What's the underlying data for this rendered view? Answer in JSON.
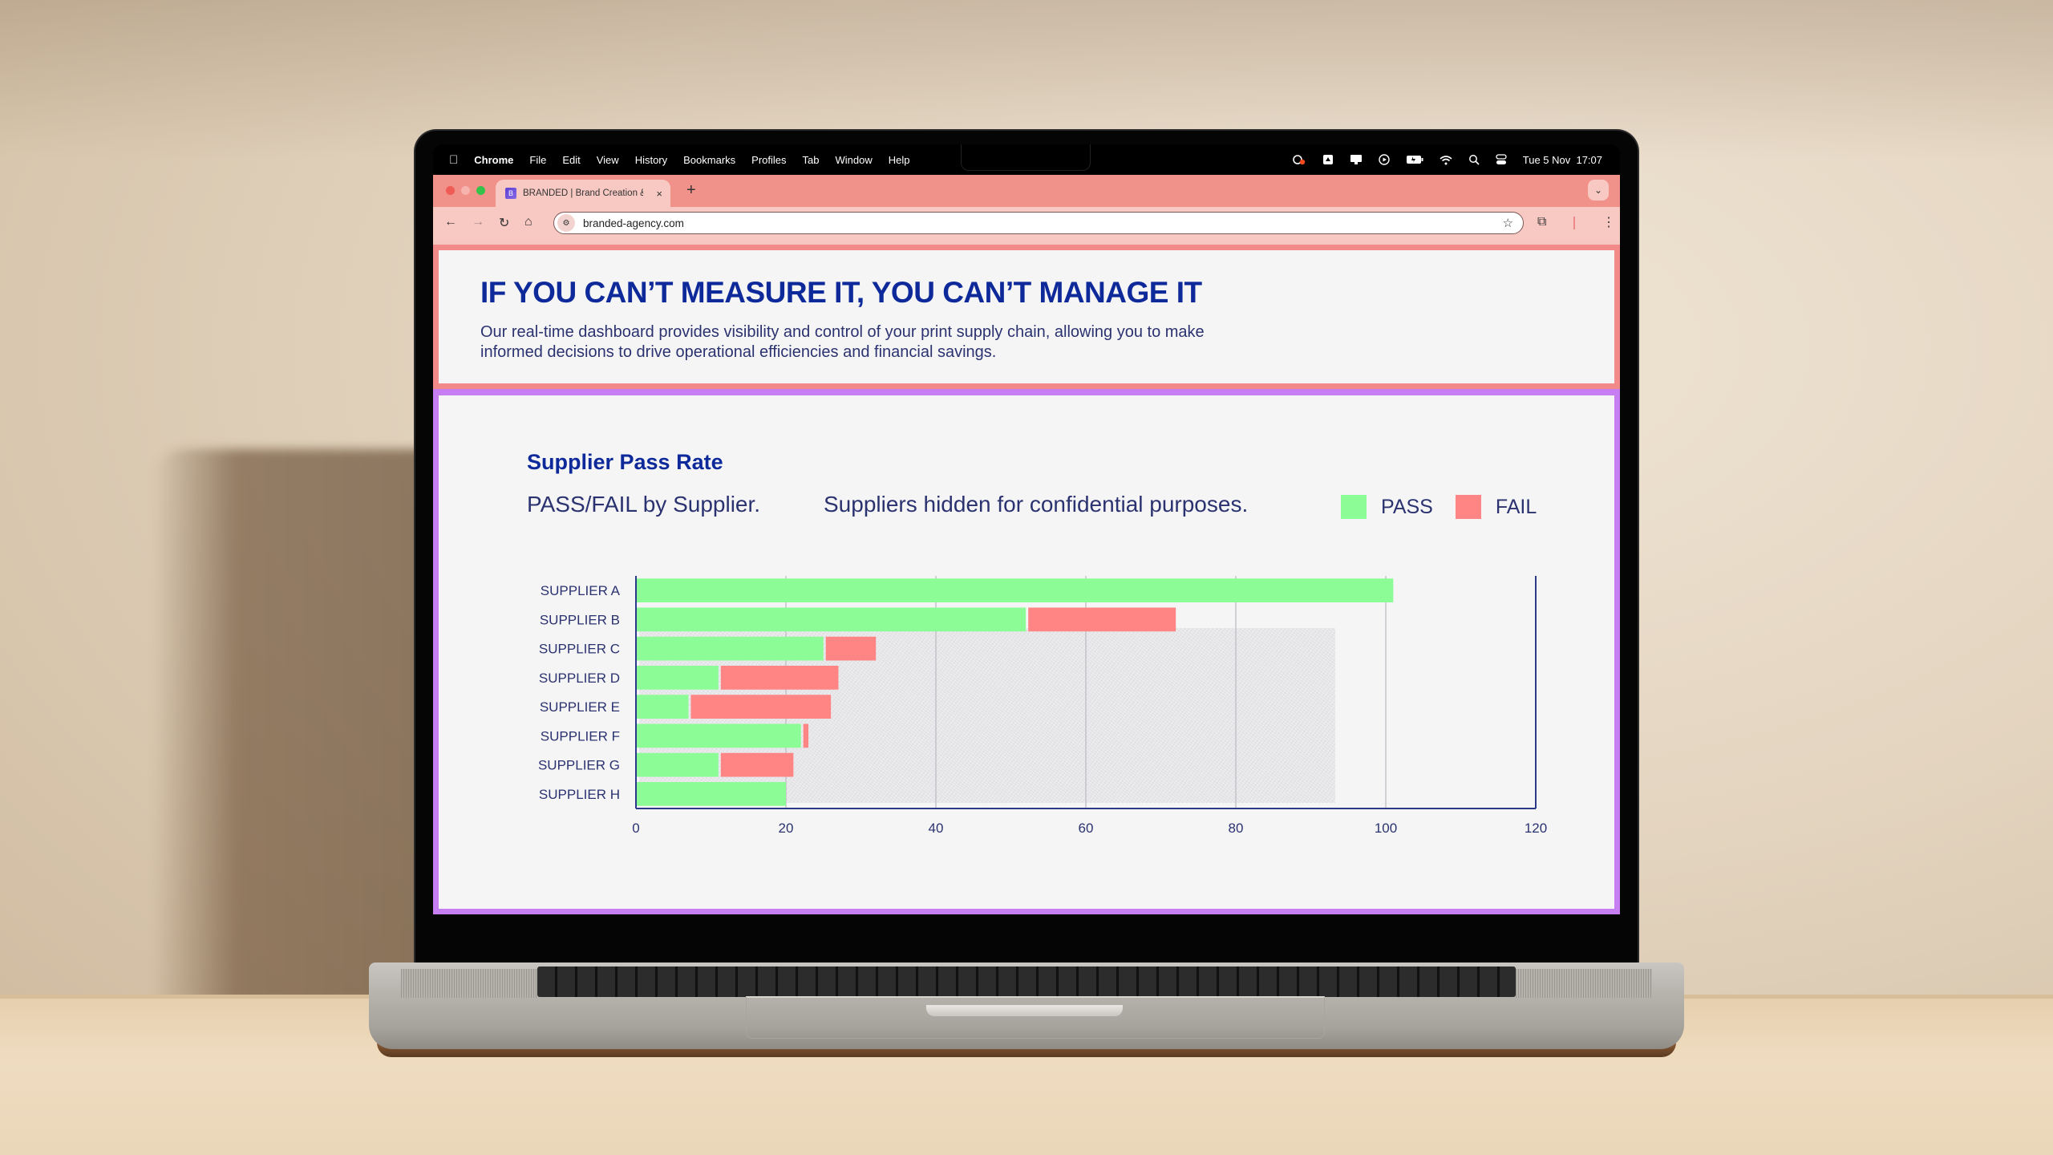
{
  "menubar": {
    "app_name": "Chrome",
    "items": [
      "File",
      "Edit",
      "View",
      "History",
      "Bookmarks",
      "Profiles",
      "Tab",
      "Window",
      "Help"
    ],
    "status_icons": [
      "creative-cloud-icon",
      "drive-icon",
      "display-icon",
      "play-icon",
      "battery-icon",
      "wifi-icon",
      "search-icon",
      "control-center-icon"
    ],
    "datetime": "Tue 5 Nov  17:07"
  },
  "browser": {
    "tab_title": "BRANDED | Brand Creation &",
    "favicon_letter": "B",
    "new_tab": "+",
    "tab_close": "×",
    "url": "branded-agency.com"
  },
  "hero": {
    "title": "IF YOU CAN’T MEASURE IT, YOU CAN’T MANAGE IT",
    "description": "Our real-time dashboard provides visibility and control of your print supply chain, allowing you to make informed decisions to drive operational efficiencies and financial savings."
  },
  "panel": {
    "title": "Supplier Pass Rate",
    "subtitle": "PASS/FAIL by Supplier.",
    "note": "Suppliers hidden for confidential purposes.",
    "legend": [
      {
        "label": "PASS",
        "color": "#8cfd96"
      },
      {
        "label": "FAIL",
        "color": "#ff8484"
      }
    ]
  },
  "colors": {
    "pass": "#8cfd96",
    "fail": "#ff8484",
    "heading": "#0e2a9a",
    "text": "#2b3270",
    "hero_border": "#f28a8a",
    "panel_border": "#c77ef2",
    "chrome_tabstrip": "#f0918a"
  },
  "chart_data": {
    "type": "bar",
    "orientation": "horizontal",
    "stacked": true,
    "title": "Supplier Pass Rate",
    "subtitle": "PASS/FAIL by Supplier.",
    "categories": [
      "SUPPLIER A",
      "SUPPLIER B",
      "SUPPLIER C",
      "SUPPLIER D",
      "SUPPLIER E",
      "SUPPLIER F",
      "SUPPLIER G",
      "SUPPLIER H"
    ],
    "series": [
      {
        "name": "PASS",
        "values": [
          101,
          52,
          25,
          11,
          7,
          22,
          11,
          20
        ]
      },
      {
        "name": "FAIL",
        "values": [
          0,
          20,
          7,
          16,
          19,
          1,
          10,
          0
        ]
      }
    ],
    "xlabel": "",
    "ylabel": "",
    "xlim": [
      0,
      120
    ],
    "xticks": [
      0,
      20,
      40,
      60,
      80,
      100,
      120
    ],
    "grid": true,
    "legend_position": "top-right"
  }
}
